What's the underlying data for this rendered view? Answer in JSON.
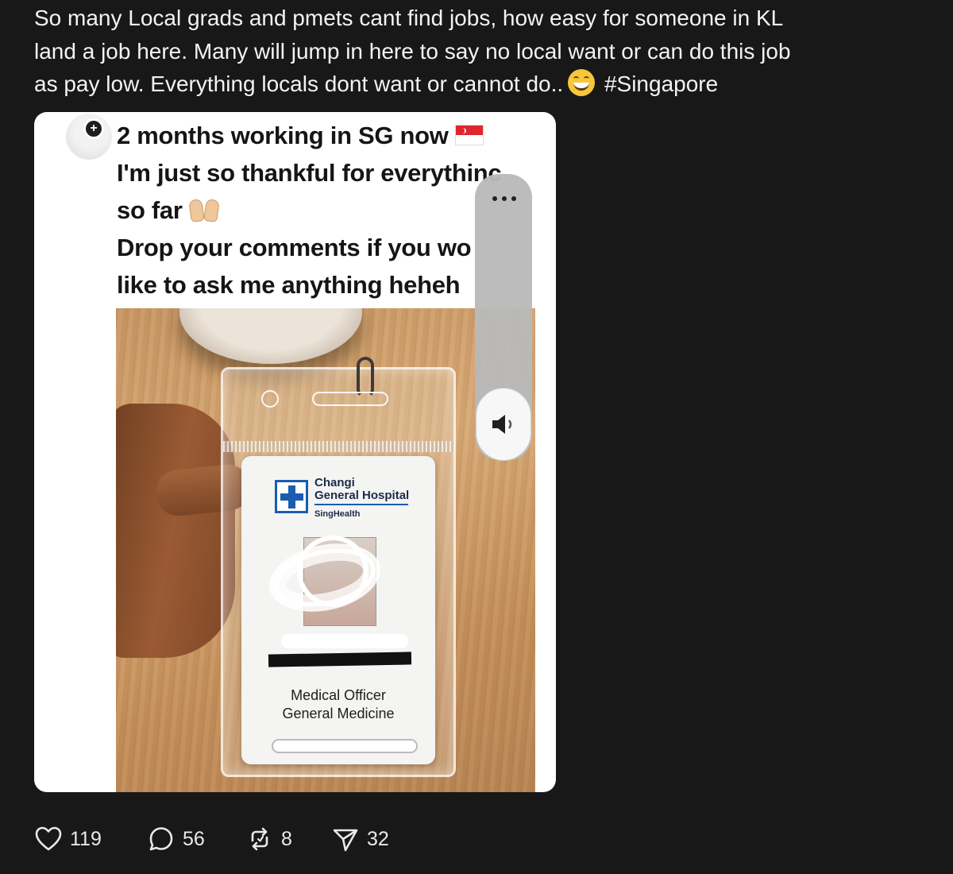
{
  "post": {
    "line1": "So many Local grads and pmets cant find jobs, how easy for someone in KL",
    "line2": "land a job here. Many will jump in here to say no local want or can do this job",
    "line3_before_emoji": "as pay low. Everything locals dont want or cannot do..",
    "hashtag": "#Singapore",
    "emoji_icon": "grinning-face-emoji"
  },
  "media": {
    "caption_line1": "2 months working in SG now",
    "caption_line2": "I'm just so thankful for everythinc",
    "caption_line3": "so far",
    "caption_line4": "Drop your comments if you wo",
    "caption_line5": "like to ask me anything  heheh",
    "badge": {
      "hospital_line1": "Changi",
      "hospital_line2": "General Hospital",
      "network": "SingHealth",
      "role_line1": "Medical Officer",
      "role_line2": "General Medicine"
    }
  },
  "actions": {
    "likes": "119",
    "comments": "56",
    "reposts": "8",
    "shares": "32"
  },
  "colors": {
    "background": "#181818",
    "text": "#f3f3f3",
    "card": "#ffffff"
  }
}
